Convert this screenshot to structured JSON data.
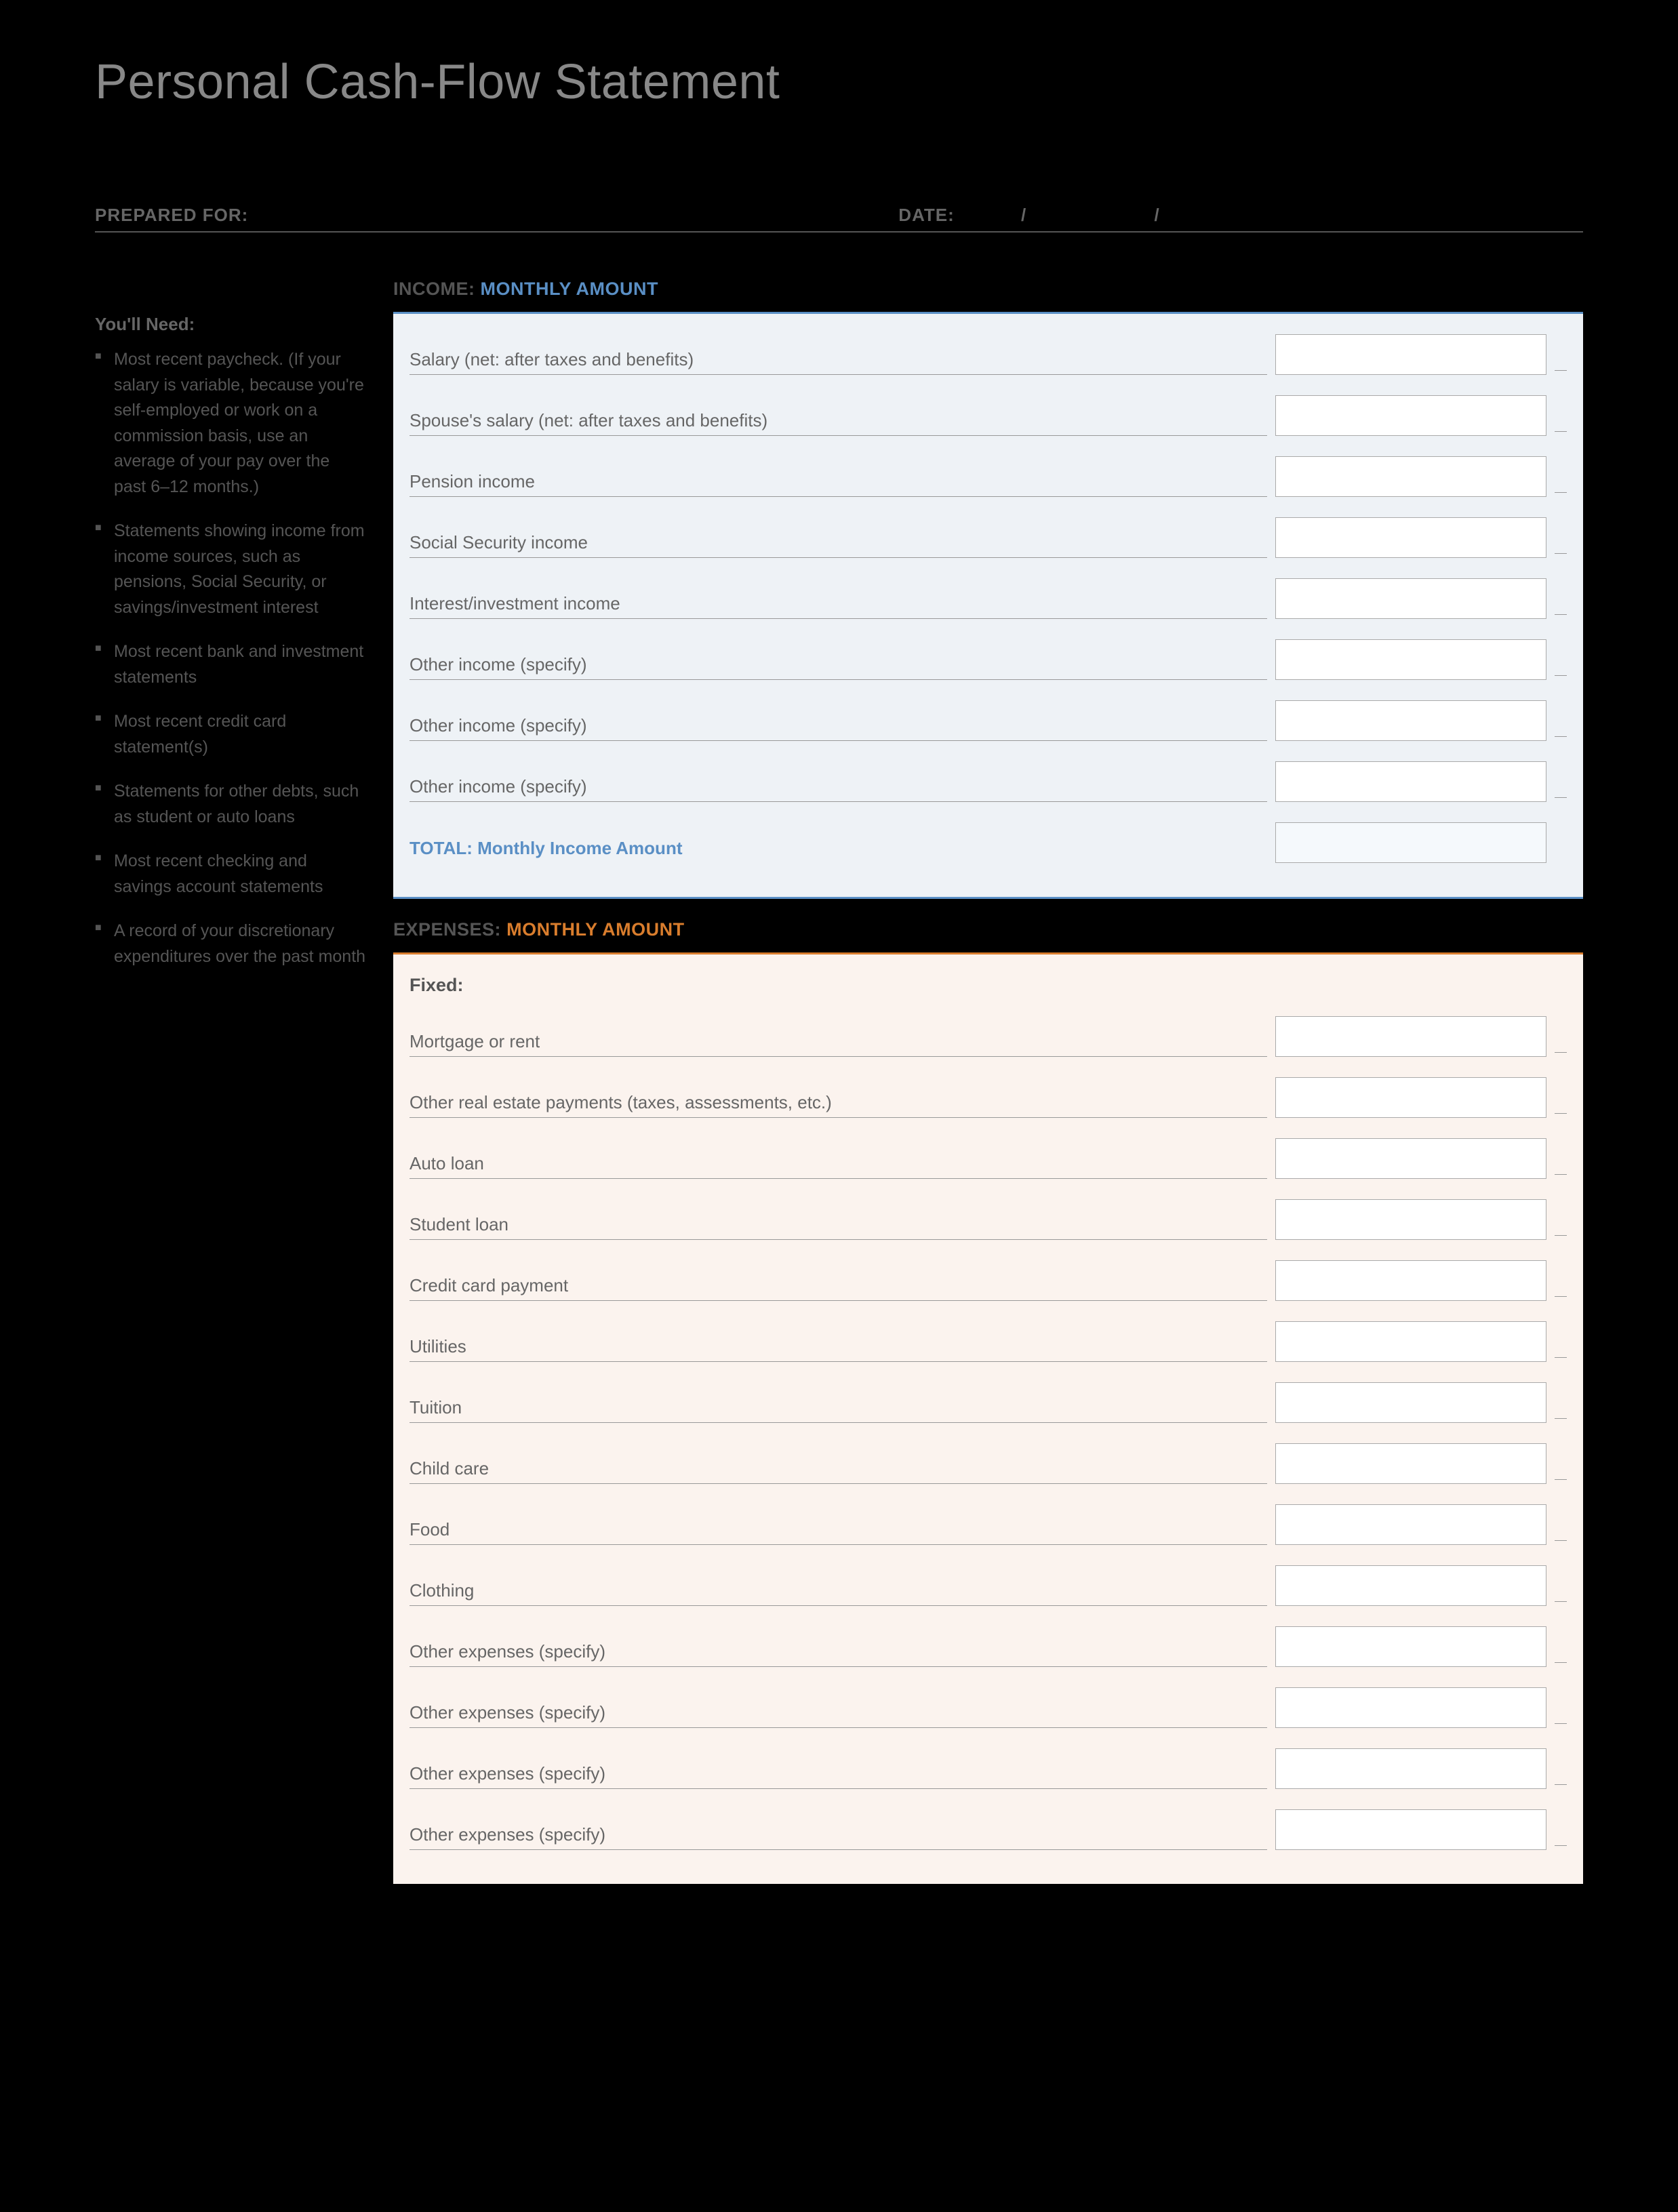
{
  "title": "Personal Cash-Flow Statement",
  "header": {
    "prepared_for_label": "PREPARED FOR:",
    "date_label": "DATE:",
    "slash": "/"
  },
  "sidebar": {
    "title": "You'll Need:",
    "items": [
      "Most recent paycheck. (If your salary is variable, because you're self-employed or work on a commission basis, use an average of your pay over the past 6–12 months.)",
      "Statements showing income from income sources, such as pensions, Social Security, or savings/investment interest",
      "Most recent bank and investment statements",
      "Most recent credit card statement(s)",
      "Statements for other debts, such as student or auto loans",
      "Most recent checking and savings account statements",
      "A record of your discretionary expenditures over the past month"
    ]
  },
  "income": {
    "header_prefix": "INCOME:",
    "header_suffix": "MONTHLY AMOUNT",
    "rows": [
      "Salary (net: after taxes and benefits)",
      "Spouse's salary (net: after taxes and benefits)",
      "Pension income",
      "Social Security income",
      "Interest/investment income",
      "Other income (specify)",
      "Other income (specify)",
      "Other income (specify)"
    ],
    "total_label": "TOTAL: Monthly Income Amount"
  },
  "expenses": {
    "header_prefix": "EXPENSES:",
    "header_suffix": "MONTHLY AMOUNT",
    "fixed_label": "Fixed:",
    "rows": [
      "Mortgage or rent",
      "Other real estate payments (taxes, assessments, etc.)",
      "Auto loan",
      "Student loan",
      "Credit card payment",
      "Utilities",
      "Tuition",
      "Child care",
      "Food",
      "Clothing",
      "Other expenses (specify)",
      "Other expenses (specify)",
      "Other expenses (specify)",
      "Other expenses (specify)"
    ]
  }
}
